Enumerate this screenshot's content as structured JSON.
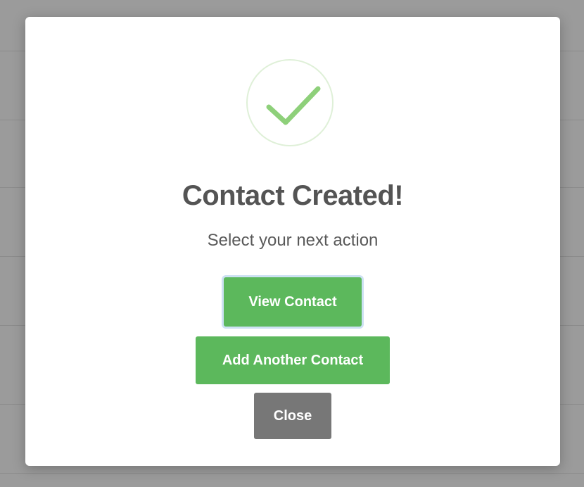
{
  "modal": {
    "title": "Contact Created!",
    "subtitle": "Select your next action",
    "icon": "checkmark-icon",
    "buttons": {
      "view_contact": "View Contact",
      "add_another": "Add Another Contact",
      "close": "Close"
    }
  },
  "colors": {
    "success_green": "#5cb85c",
    "check_green": "#8ed07a",
    "close_gray": "#777777",
    "title_gray": "#545454",
    "backdrop": "#9b9b9b"
  }
}
